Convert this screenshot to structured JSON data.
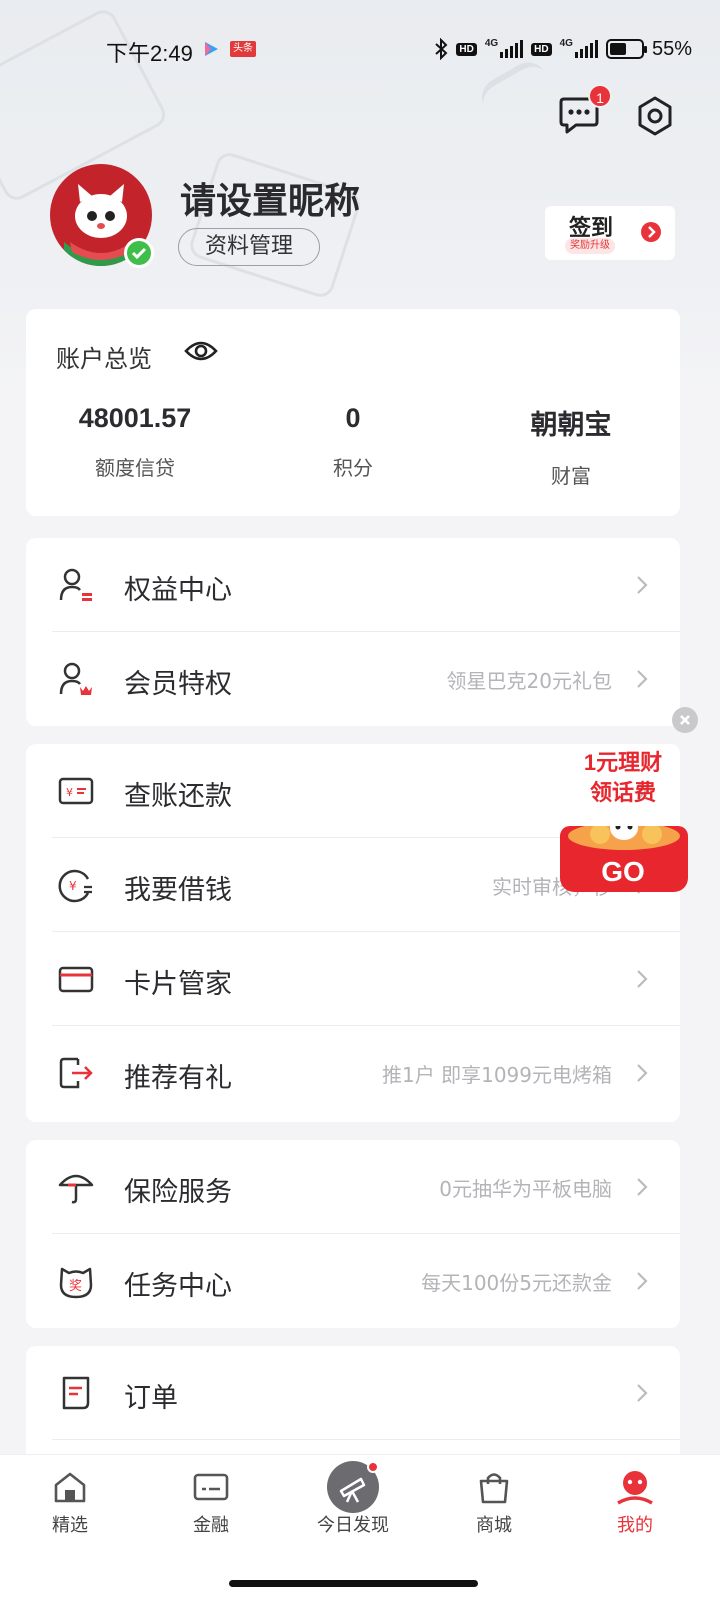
{
  "status_bar": {
    "time": "下午2:49",
    "app_badge": "头条",
    "hd1": "HD",
    "hd2": "HD",
    "net1": "4G",
    "net2": "4G",
    "battery_percent": "55%",
    "battery_level": 0.55
  },
  "header": {
    "message_badge": "1"
  },
  "profile": {
    "nickname": "请设置昵称",
    "manage_label": "资料管理",
    "signin_label": "签到",
    "signin_sub": "奖励升级"
  },
  "account": {
    "title": "账户总览",
    "stats": [
      {
        "value": "48001.57",
        "label": "额度信贷"
      },
      {
        "value": "0",
        "label": "积分"
      },
      {
        "value": "朝朝宝",
        "label": "财富"
      }
    ]
  },
  "menu_groups": [
    {
      "items": [
        {
          "icon": "user-benefits-icon",
          "label": "权益中心",
          "hint": ""
        },
        {
          "icon": "user-crown-icon",
          "label": "会员特权",
          "hint": "领星巴克20元礼包"
        }
      ]
    },
    {
      "items": [
        {
          "icon": "bill-repay-icon",
          "label": "查账还款",
          "hint": ""
        },
        {
          "icon": "borrow-money-icon",
          "label": "我要借钱",
          "hint": "实时审核，秒"
        },
        {
          "icon": "card-icon",
          "label": "卡片管家",
          "hint": ""
        },
        {
          "icon": "referral-exit-icon",
          "label": "推荐有礼",
          "hint": "推1户 即享1099元电烤箱"
        }
      ]
    },
    {
      "items": [
        {
          "icon": "umbrella-icon",
          "label": "保险服务",
          "hint": "0元抽华为平板电脑"
        },
        {
          "icon": "task-cat-icon",
          "label": "任务中心",
          "hint": "每天100份5元还款金"
        }
      ]
    },
    {
      "items": [
        {
          "icon": "order-icon",
          "label": "订单",
          "hint": ""
        }
      ]
    }
  ],
  "promo": {
    "line1": "1元理财",
    "line2": "领话费",
    "cta": "GO"
  },
  "bottom_nav": [
    {
      "label": "精选",
      "icon": "home-icon"
    },
    {
      "label": "金融",
      "icon": "finance-card-icon"
    },
    {
      "label": "今日发现",
      "icon": "telescope-icon"
    },
    {
      "label": "商城",
      "icon": "shopping-bag-icon"
    },
    {
      "label": "我的",
      "icon": "profile-face-icon",
      "active": true
    }
  ],
  "colors": {
    "accent_red": "#e8333a",
    "text_dark": "#2c2c30",
    "hint_gray": "#b4b4b8"
  }
}
